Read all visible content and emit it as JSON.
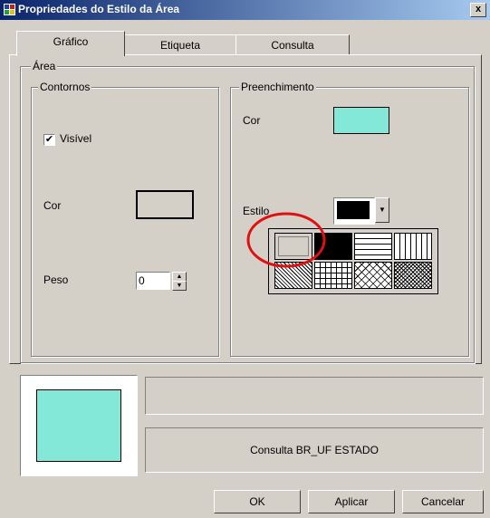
{
  "window": {
    "title": "Propriedades do Estilo da Área",
    "close_label": "x"
  },
  "tabs": [
    {
      "label": "Gráfico",
      "active": true
    },
    {
      "label": "Etiqueta",
      "active": false
    },
    {
      "label": "Consulta",
      "active": false
    }
  ],
  "area_group": {
    "legend": "Área"
  },
  "contornos": {
    "legend": "Contornos",
    "visible_label": "Visível",
    "visible_checked": true,
    "check_mark": "✔",
    "cor_label": "Cor",
    "cor_color": "#d4d0c8",
    "peso_label": "Peso",
    "peso_value": "0"
  },
  "preenchimento": {
    "legend": "Preenchimento",
    "cor_label": "Cor",
    "cor_color": "#84e8d8",
    "estilo_label": "Estilo",
    "estilo_selected_color": "#000000",
    "palette": [
      "empty",
      "solid",
      "horizontal-lines",
      "vertical-lines",
      "diagonal-hatch",
      "grid",
      "diagonal-cross",
      "dense-crosshatch"
    ],
    "highlight_color": "#e01010"
  },
  "preview": {
    "fill_color": "#84e8d8",
    "query_text": "Consulta BR_UF ESTADO"
  },
  "buttons": {
    "ok": "OK",
    "apply": "Aplicar",
    "cancel": "Cancelar"
  }
}
